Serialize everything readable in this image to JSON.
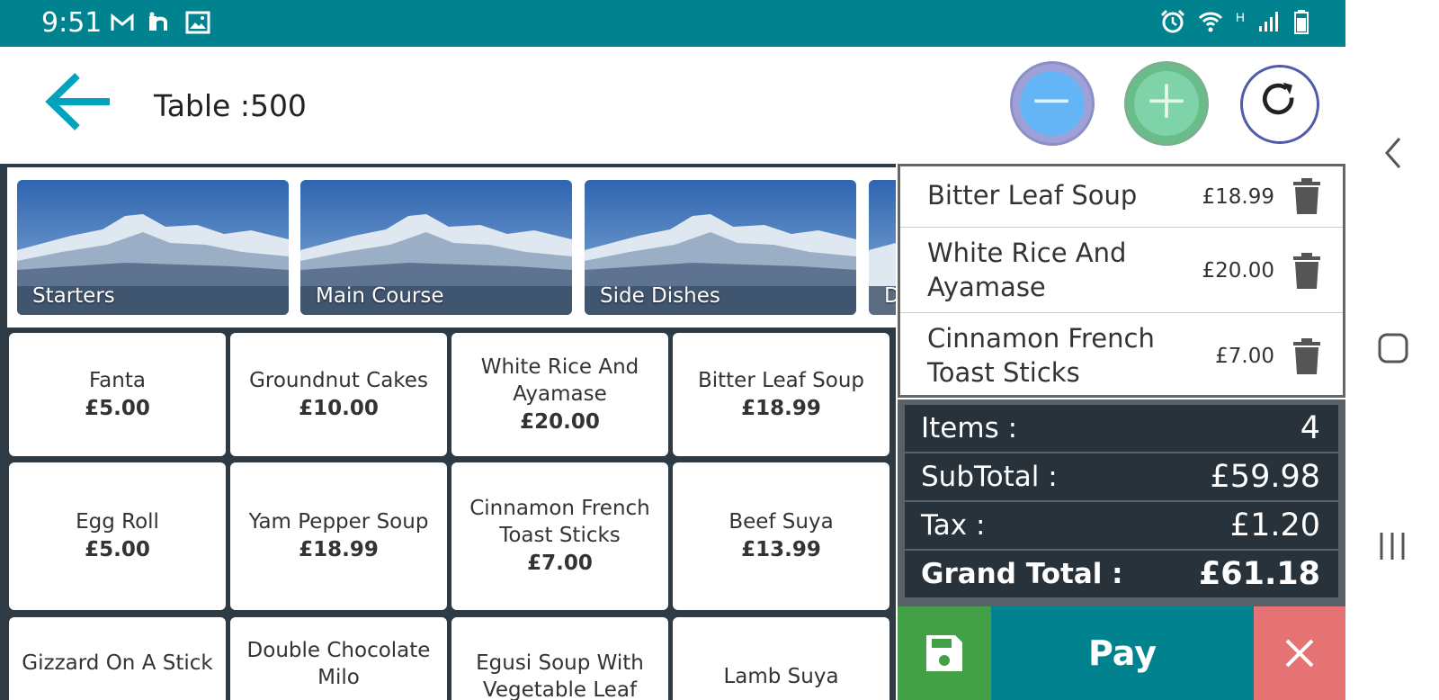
{
  "status_bar": {
    "time": "9:51",
    "left_icons": [
      "gmail-icon",
      "notification-n-icon",
      "image-icon"
    ],
    "right_icons": [
      "alarm-icon",
      "wifi-icon",
      "signal-icon",
      "battery-icon"
    ],
    "network_label": "H"
  },
  "header": {
    "title": "Table :500"
  },
  "categories": [
    {
      "label": "Starters"
    },
    {
      "label": "Main Course"
    },
    {
      "label": "Side Dishes"
    },
    {
      "label": "D"
    }
  ],
  "products": [
    {
      "name": "Fanta",
      "price": "£5.00"
    },
    {
      "name": "Groundnut Cakes",
      "price": "£10.00"
    },
    {
      "name": "White Rice And Ayamase",
      "price": "£20.00"
    },
    {
      "name": "Bitter Leaf Soup",
      "price": "£18.99"
    },
    {
      "name": "Egg Roll",
      "price": "£5.00"
    },
    {
      "name": "Yam Pepper Soup",
      "price": "£18.99"
    },
    {
      "name": "Cinnamon French Toast Sticks",
      "price": "£7.00"
    },
    {
      "name": "Beef Suya",
      "price": "£13.99"
    },
    {
      "name": "Gizzard On A Stick",
      "price": ""
    },
    {
      "name": "Double Chocolate Milo",
      "price": ""
    },
    {
      "name": "Egusi Soup With Vegetable Leaf",
      "price": ""
    },
    {
      "name": "Lamb Suya",
      "price": ""
    }
  ],
  "order_items": [
    {
      "name": "Bitter Leaf Soup",
      "price": "£18.99"
    },
    {
      "name": "White Rice And Ayamase",
      "price": "£20.00"
    },
    {
      "name": "Cinnamon French Toast Sticks",
      "price": "£7.00"
    }
  ],
  "totals": {
    "items_label": "Items :",
    "items_value": "4",
    "subtotal_label": "SubTotal :",
    "subtotal_value": "£59.98",
    "tax_label": "Tax :",
    "tax_value": "£1.20",
    "grand_total_label": "Grand Total :",
    "grand_total_value": "£61.18"
  },
  "actions": {
    "pay_label": "Pay"
  },
  "colors": {
    "primary": "#00838f",
    "save": "#43a047",
    "cancel": "#e57373",
    "dark_panel": "#27323a"
  }
}
